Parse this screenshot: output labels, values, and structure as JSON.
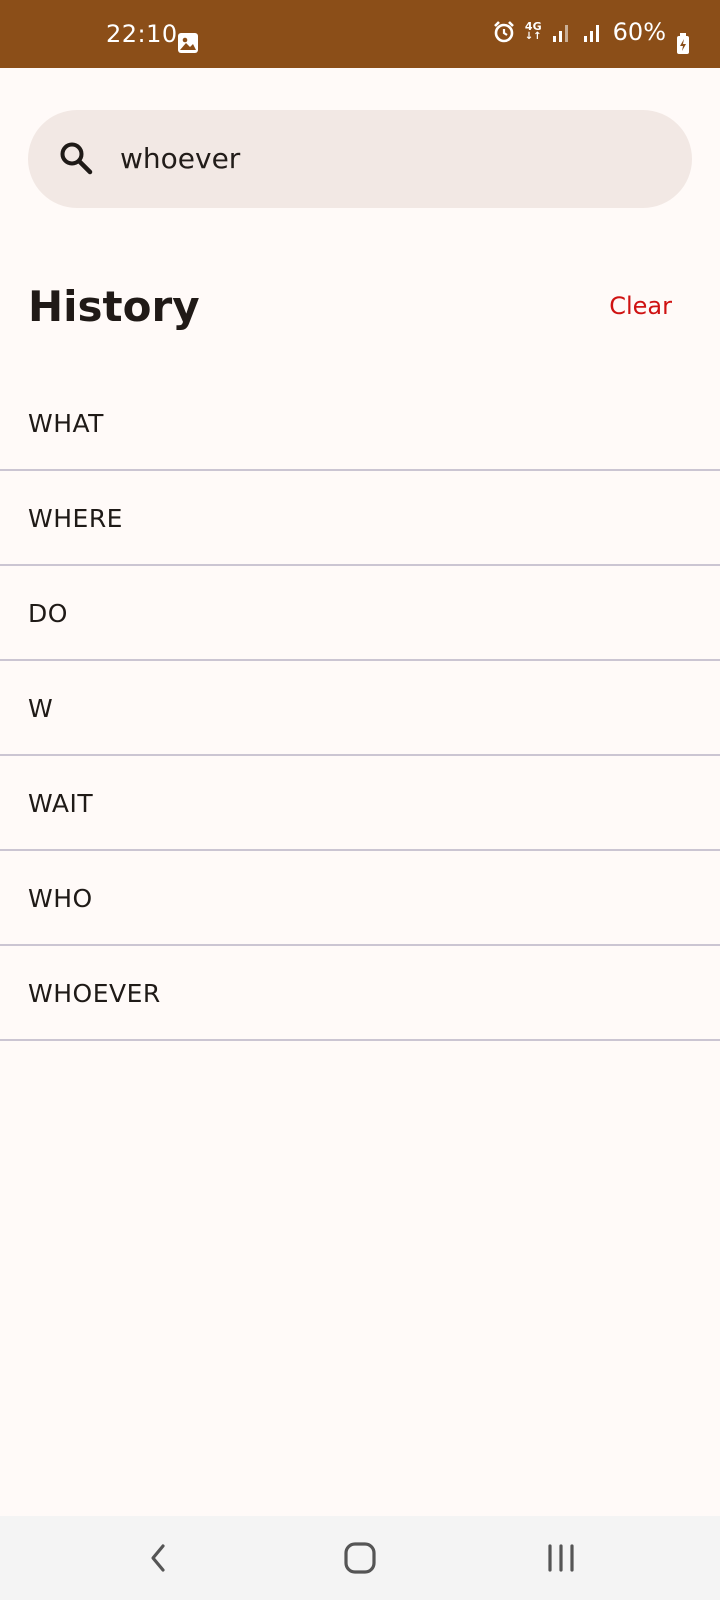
{
  "status_bar": {
    "time": "22:10",
    "battery": "60%",
    "network": "4G",
    "background_color": "#8b4e18",
    "icons": [
      "gallery-icon",
      "alarm-icon",
      "network-4g-icon",
      "signal-icon",
      "signal-icon",
      "battery-icon"
    ]
  },
  "search": {
    "value": "whoever",
    "icon": "search-icon"
  },
  "history": {
    "title": "History",
    "clear_label": "Clear",
    "clear_color": "#cf1212",
    "items": [
      "WHAT",
      "WHERE",
      "DO",
      "W",
      "WAIT",
      "WHO",
      "WHOEVER"
    ]
  },
  "nav_bar": {
    "buttons": [
      "back-icon",
      "home-icon",
      "recents-icon"
    ]
  }
}
